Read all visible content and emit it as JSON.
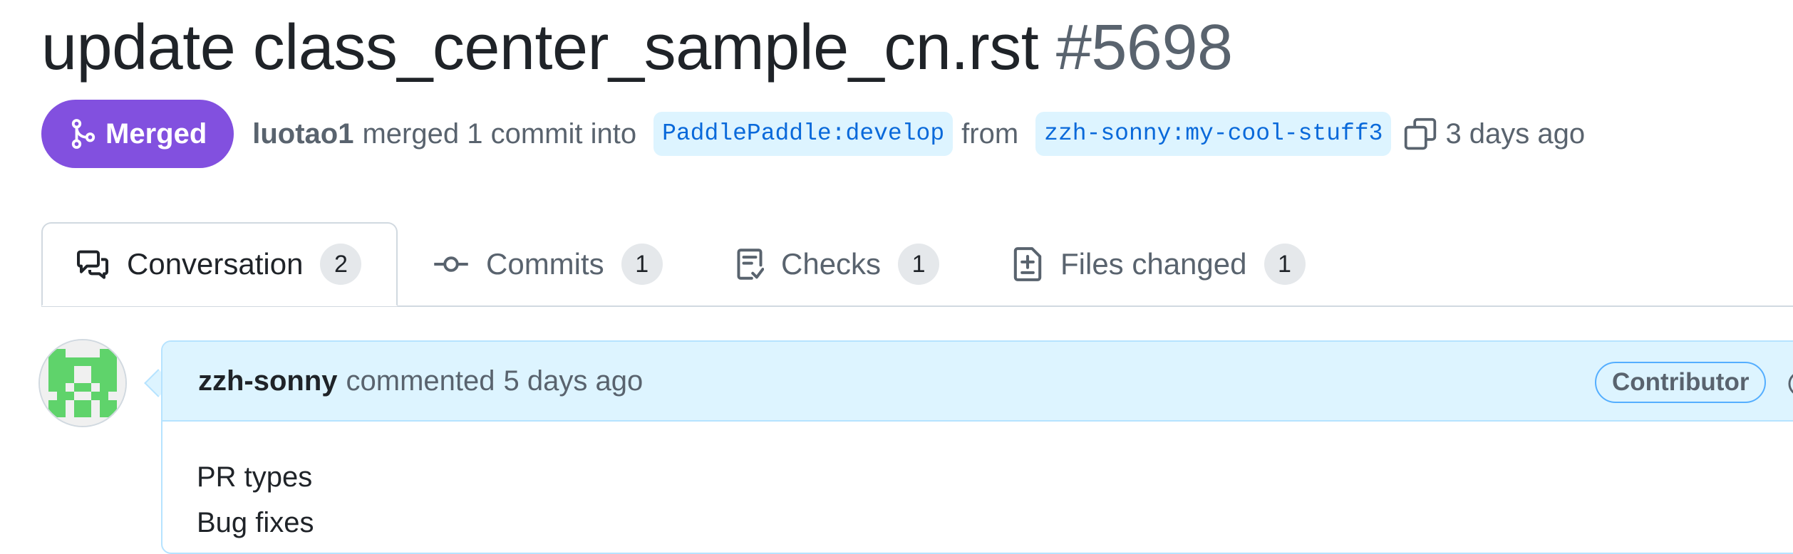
{
  "pr": {
    "title": "update class_center_sample_cn.rst",
    "number": "#5698",
    "state": "Merged",
    "author": "luotao1",
    "merge_text": "merged 1 commit into",
    "base_branch": "PaddlePaddle:develop",
    "from_text": "from",
    "head_branch": "zzh-sonny:my-cool-stuff3",
    "time": "3 days ago"
  },
  "tabs": [
    {
      "label": "Conversation",
      "count": "2",
      "icon": "conversation-icon"
    },
    {
      "label": "Commits",
      "count": "1",
      "icon": "commit-icon"
    },
    {
      "label": "Checks",
      "count": "1",
      "icon": "checklist-icon"
    },
    {
      "label": "Files changed",
      "count": "1",
      "icon": "file-diff-icon"
    }
  ],
  "comment": {
    "author": "zzh-sonny",
    "action": "commented",
    "time": "5 days ago",
    "role": "Contributor",
    "body": [
      "PR types",
      "Bug fixes"
    ]
  },
  "colors": {
    "merged": "#8250df",
    "link": "#0969da",
    "branch_bg": "#ddf4ff",
    "comment_header_bg": "#ddf4ff",
    "avatar_green": "#5fd36b"
  }
}
